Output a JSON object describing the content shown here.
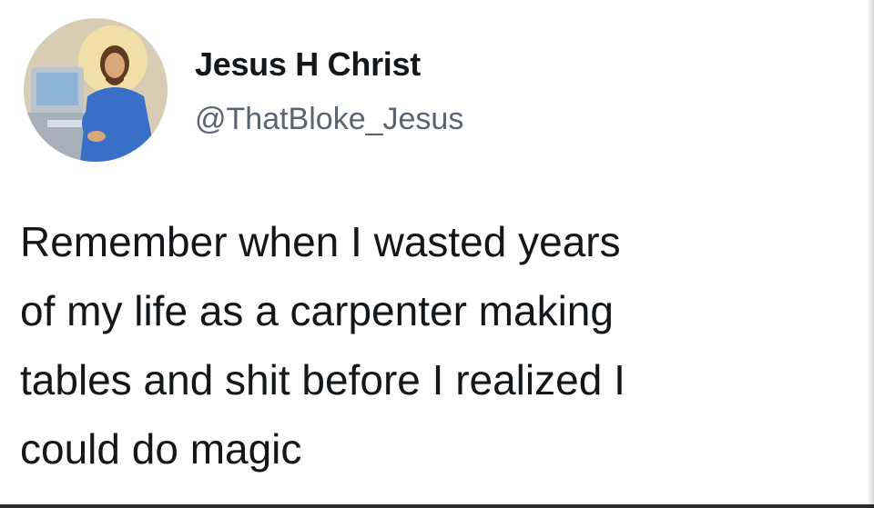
{
  "tweet": {
    "display_name": "Jesus H Christ",
    "handle": "@ThatBloke_Jesus",
    "text": "Remember when I wasted years\nof my life as a carpenter making\ntables and shit before I realized I\ncould do magic"
  },
  "avatar": {
    "icon": "profile-picture",
    "colors": {
      "background": "#d9c9a8",
      "halo": "#f0d98a",
      "shirt": "#3a6fc7",
      "monitor": "#cfd7df",
      "hair": "#6b4426"
    }
  }
}
